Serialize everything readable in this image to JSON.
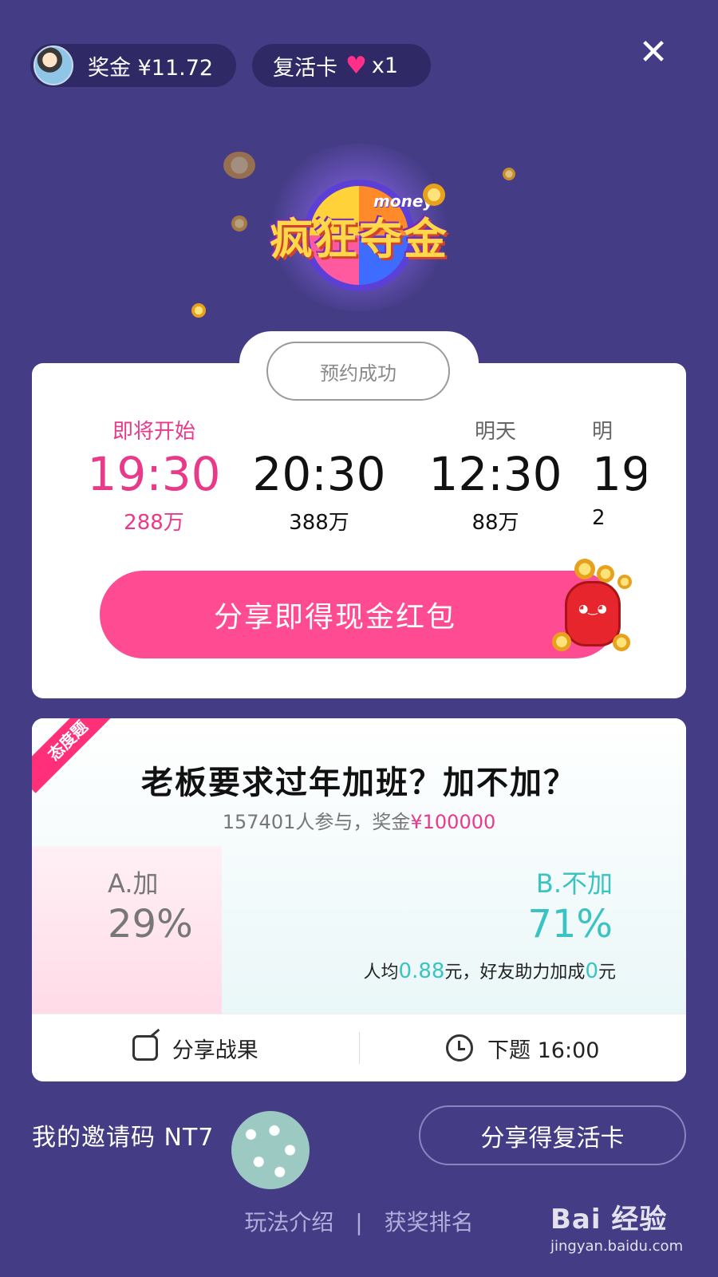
{
  "header": {
    "bonus_label": "奖金 ¥11.72",
    "revive_label": "复活卡",
    "revive_count": "x1",
    "close_glyph": "✕"
  },
  "logo": {
    "title": "疯狂夺金",
    "subtitle": "money"
  },
  "schedule": {
    "booked_label": "预约成功",
    "sessions": [
      {
        "day": "即将开始",
        "time": "19:30",
        "prize": "288万"
      },
      {
        "day": "",
        "time": "20:30",
        "prize": "388万"
      },
      {
        "day": "明天",
        "time": "12:30",
        "prize": "88万"
      },
      {
        "day": "明",
        "time": "19",
        "prize": "2"
      }
    ],
    "share_label": "分享即得现金红包"
  },
  "poll": {
    "tag": "态度题",
    "question": "老板要求过年加班？加不加？",
    "participants": "157401人参与，奖金",
    "prize": "¥100000",
    "option_a": {
      "label": "A.加",
      "percent": "29%"
    },
    "option_b": {
      "label": "B.不加",
      "percent": "71%"
    },
    "avg_prefix": "人均",
    "avg_value": "0.88",
    "avg_mid": "元，好友助力加成",
    "avg_bonus": "0",
    "avg_suffix": "元",
    "share_result": "分享战果",
    "next_question": "下题 16:00"
  },
  "footer": {
    "invite_label": "我的邀请码 NT7",
    "revive_share": "分享得复活卡",
    "rules": "玩法介绍",
    "separator": "|",
    "ranking": "获奖排名"
  },
  "watermark": {
    "logo": "Bai 经验",
    "url": "jingyan.baidu.com"
  },
  "colors": {
    "background": "#443c85",
    "accent_pink": "#ff4b92",
    "accent_teal": "#3bc3c3"
  }
}
